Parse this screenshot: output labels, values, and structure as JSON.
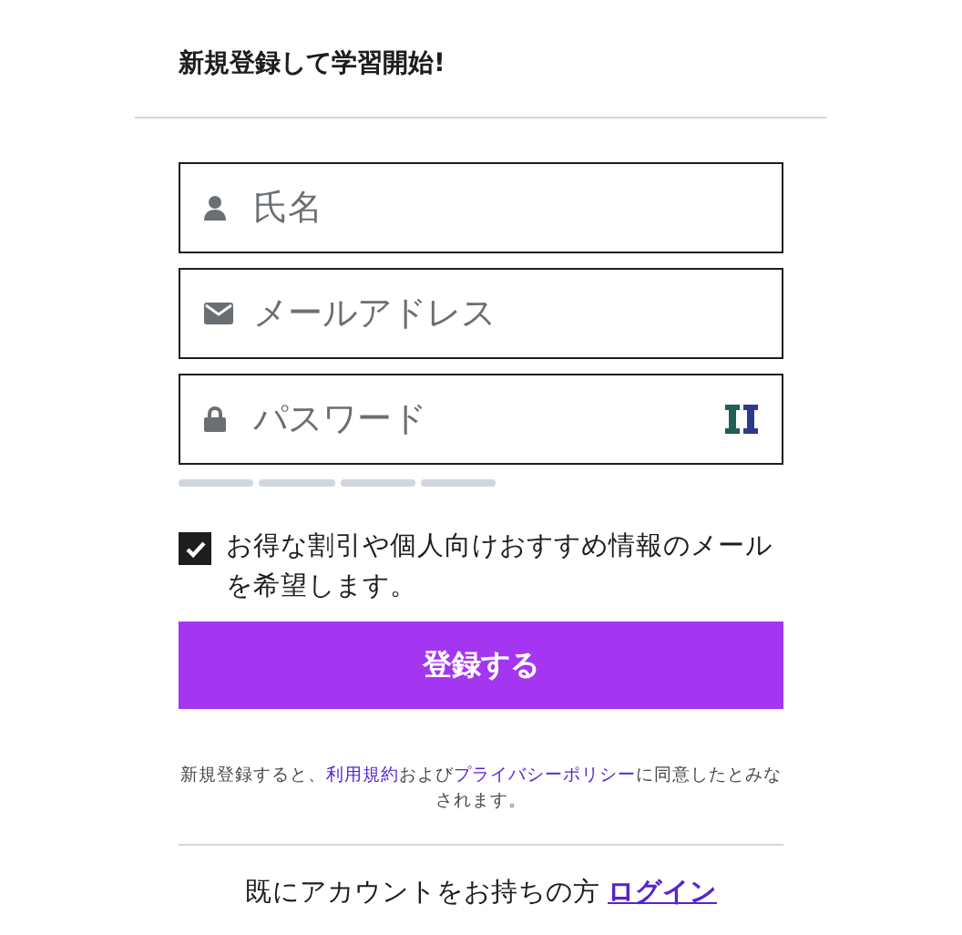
{
  "heading": "新規登録して学習開始!",
  "fields": [
    {
      "kind": "person",
      "placeholder": "氏名"
    },
    {
      "kind": "mail",
      "placeholder": "メールアドレス"
    },
    {
      "kind": "lock",
      "placeholder": "パスワード",
      "reveal": true
    }
  ],
  "newsletter": {
    "label": "お得な割引や個人向けおすすめ情報のメールを希望します。",
    "checked": true
  },
  "submit_button": "登録する",
  "terms": [
    {
      "kind": "text",
      "text": "新規登録すると、"
    },
    {
      "kind": "link",
      "text": "利用規約"
    },
    {
      "kind": "text",
      "text": "および"
    },
    {
      "kind": "link",
      "text": "プライバシーポリシー"
    },
    {
      "kind": "text",
      "text": "に同意したとみなされます。"
    }
  ],
  "login": {
    "text": "既にアカウントをお持ちの方",
    "link": "ログイン"
  }
}
